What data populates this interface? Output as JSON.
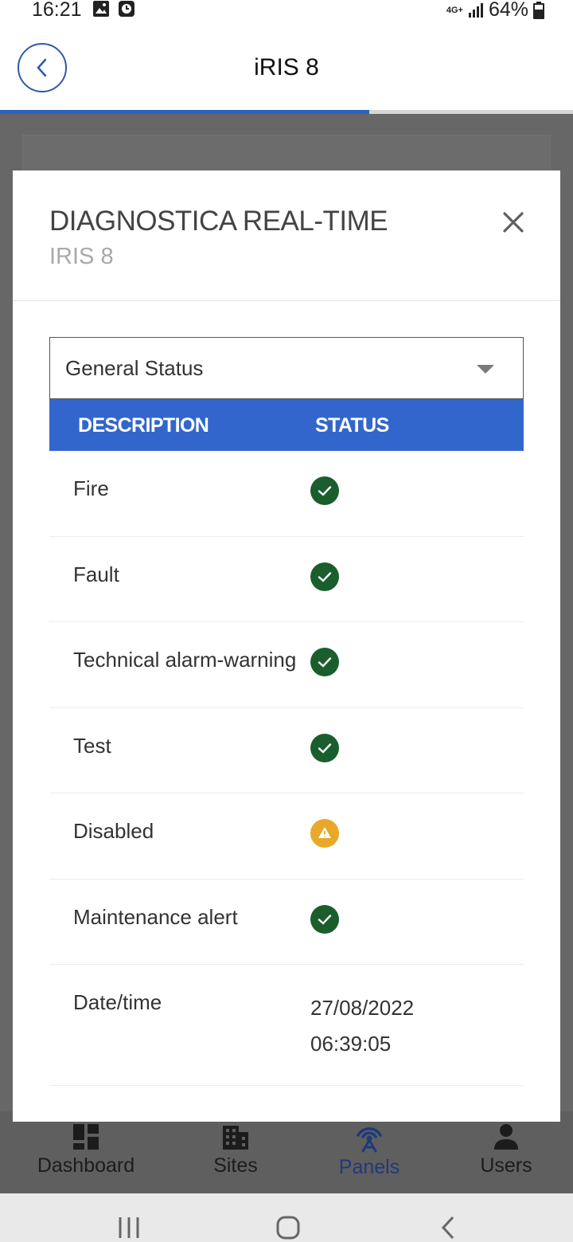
{
  "status_bar": {
    "time": "16:21",
    "network": "4G+",
    "battery": "64%",
    "icons": [
      "gallery-icon",
      "clock-icon",
      "signal-icon",
      "battery-icon"
    ]
  },
  "header": {
    "title": "iRIS 8",
    "back_icon": "chevron-left-icon",
    "progress": 0.645,
    "accent_color": "#2f5fc4"
  },
  "modal": {
    "title": "DIAGNOSTICA REAL-TIME",
    "subtitle": "IRIS 8",
    "close_icon": "close-icon",
    "select": {
      "value": "General Status"
    },
    "table": {
      "columns": [
        "DESCRIPTION",
        "STATUS"
      ],
      "header_color": "#3366cc",
      "rows": [
        {
          "description": "Fire",
          "status": "ok"
        },
        {
          "description": "Fault",
          "status": "ok"
        },
        {
          "description": "Technical alarm-warning",
          "status": "ok"
        },
        {
          "description": "Test",
          "status": "ok"
        },
        {
          "description": "Disabled",
          "status": "warning"
        },
        {
          "description": "Maintenance alert",
          "status": "ok"
        }
      ],
      "date_row": {
        "description": "Date/time",
        "date": "27/08/2022",
        "time": "06:39:05"
      }
    },
    "status_colors": {
      "ok": "#1a5e2e",
      "warning": "#e8a82a"
    }
  },
  "bottom_nav": {
    "items": [
      {
        "label": "Dashboard",
        "icon": "dashboard-icon",
        "active": false
      },
      {
        "label": "Sites",
        "icon": "building-icon",
        "active": false
      },
      {
        "label": "Panels",
        "icon": "antenna-icon",
        "active": true
      },
      {
        "label": "Users",
        "icon": "user-icon",
        "active": false
      }
    ]
  },
  "system_nav": {
    "buttons": [
      "recents-icon",
      "home-icon",
      "back-icon"
    ]
  }
}
